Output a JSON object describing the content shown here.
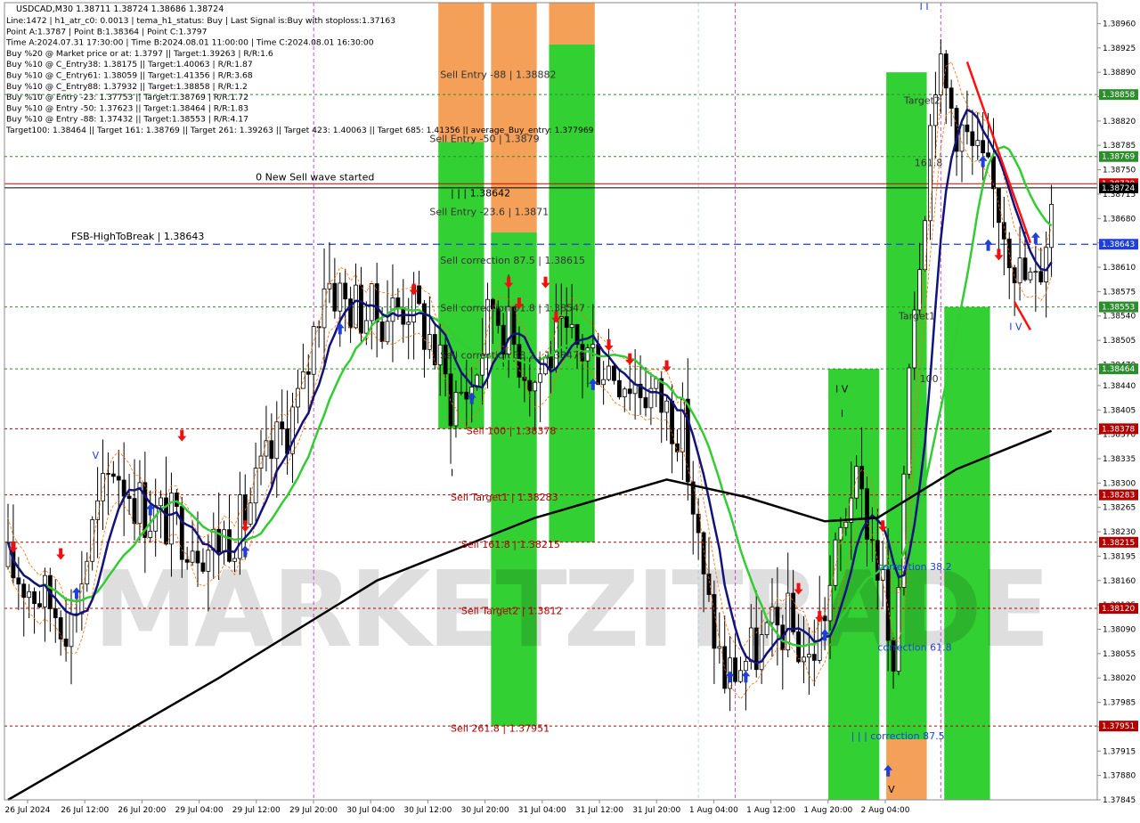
{
  "title": "USDCAD,M30  1.38711 1.38724 1.38686 1.38724",
  "info_lines": [
    "Line:1472 | h1_atr_c0: 0.0013 | tema_h1_status: Buy | Last Signal is:Buy with stoploss:1.37163",
    "Point A:1.3787 | Point B:1.38364 | Point C:1.3797",
    "Time A:2024.07.31 17:30:00 | Time B:2024.08.01 11:00:00 | Time C:2024.08.01 16:30:00",
    "Buy %20 @ Market price or at: 1.3797 || Target:1.39263 | R/R:1.6",
    "Buy %10 @ C_Entry38: 1.38175 || Target:1.40063 | R/R:1.87",
    "Buy %10 @ C_Entry61: 1.38059 || Target:1.41356 | R/R:3.68",
    "Buy %10 @ C_Entry88: 1.37932 || Target:1.38858 | R/R:1.2",
    "Buy %10 @ Entry -23: 1.37753 || Target:1.38769 | R/R:1.72",
    "Buy %10 @ Entry -50: 1.37623 || Target:1.38464 | R/R:1.83",
    "Buy %10 @ Entry -88: 1.37432 || Target:1.38553 | R/R:4.17",
    "Target100: 1.38464 || Target 161: 1.38769 || Target 261: 1.39263 || Target 423: 1.40063 || Target 685: 1.41356 || average_Buy_entry: 1.377969"
  ],
  "chart_data": {
    "type": "candlestick",
    "symbol": "USDCAD",
    "timeframe": "M30",
    "ylim": [
      1.37845,
      1.3899
    ],
    "y_ticks": [
      "1.38960",
      "1.38925",
      "1.38890",
      "1.38855",
      "1.38820",
      "1.38785",
      "1.38750",
      "1.38715",
      "1.38680",
      "1.38645",
      "1.38610",
      "1.38575",
      "1.38540",
      "1.38505",
      "1.38470",
      "1.38440",
      "1.38405",
      "1.38370",
      "1.38335",
      "1.38300",
      "1.38265",
      "1.38230",
      "1.38195",
      "1.38160",
      "1.38125",
      "1.38090",
      "1.38055",
      "1.38020",
      "1.37985",
      "1.37950",
      "1.37915",
      "1.37880",
      "1.37845"
    ],
    "x_ticks": [
      "26 Jul 2024",
      "26 Jul 12:00",
      "26 Jul 20:00",
      "29 Jul 04:00",
      "29 Jul 12:00",
      "29 Jul 20:00",
      "30 Jul 04:00",
      "30 Jul 12:00",
      "30 Jul 20:00",
      "31 Jul 04:00",
      "31 Jul 12:00",
      "31 Jul 20:00",
      "1 Aug 04:00",
      "1 Aug 12:00",
      "1 Aug 20:00",
      "2 Aug 04:00"
    ],
    "levels": [
      {
        "price": 1.38858,
        "label": "1.38858",
        "color": "#2e8b2e",
        "style": "dotted"
      },
      {
        "price": 1.38769,
        "label": "1.38769",
        "color": "#2e8b2e",
        "style": "dotted"
      },
      {
        "price": 1.3873,
        "label": "1.38730",
        "color": "#d40000",
        "style": "solid"
      },
      {
        "price": 1.38724,
        "label": "1.38724",
        "color": "#000000",
        "style": "solid"
      },
      {
        "price": 1.38643,
        "label": "1.38643",
        "color": "#1f3fd8",
        "style": "dashed"
      },
      {
        "price": 1.38553,
        "label": "1.38553",
        "color": "#2e8b2e",
        "style": "dotted"
      },
      {
        "price": 1.38464,
        "label": "1.38464",
        "color": "#2e8b2e",
        "style": "dotted"
      },
      {
        "price": 1.38378,
        "label": "1.38378",
        "color": "#b00000",
        "style": "dotted"
      },
      {
        "price": 1.38283,
        "label": "1.38283",
        "color": "#b00000",
        "style": "dotted"
      },
      {
        "price": 1.38215,
        "label": "1.38215",
        "color": "#b00000",
        "style": "dotted"
      },
      {
        "price": 1.3812,
        "label": "1.38120",
        "color": "#b00000",
        "style": "dotted"
      },
      {
        "price": 1.37951,
        "label": "1.37951",
        "color": "#b00000",
        "style": "dotted"
      }
    ],
    "zones": [
      {
        "color": "#f08020",
        "i0": 82,
        "i1": 90,
        "top": 1.3899,
        "bottom": 1.38378,
        "split": 1.3879
      },
      {
        "color": "#f08020",
        "i0": 92,
        "i1": 100,
        "top": 1.3899,
        "bottom": 1.37951,
        "split": 1.3866
      },
      {
        "color": "#f08020",
        "i0": 103,
        "i1": 111,
        "top": 1.3899,
        "bottom": 1.38215,
        "split": 1.3893
      },
      {
        "color": "#22cc22",
        "i0": 156,
        "i1": 165,
        "top": 1.38464,
        "bottom": 1.37845,
        "split": null
      },
      {
        "color": "#22cc22",
        "i0": 167,
        "i1": 174,
        "top": 1.3889,
        "bottom": 1.37845,
        "split": 1.37932,
        "low_color": "#f08020"
      },
      {
        "color": "#22cc22",
        "i0": 178,
        "i1": 186,
        "top": 1.38553,
        "bottom": 1.37845,
        "split": null
      }
    ],
    "labels": [
      {
        "text": "Sell Entry -88 | 1.38882",
        "i": 82,
        "price": 1.38882,
        "color": "#333333"
      },
      {
        "text": "Sell Entry -50 | 1.3879",
        "i": 80,
        "price": 1.3879,
        "color": "#333333"
      },
      {
        "text": "| | | 1.38642",
        "i": 84,
        "price": 1.38712,
        "color": "#000000"
      },
      {
        "text": "Sell Entry -23.6 | 1.3871",
        "i": 80,
        "price": 1.38685,
        "color": "#333333"
      },
      {
        "text": "0 New Sell wave started",
        "i": 47,
        "price": 1.38735,
        "color": "#000000"
      },
      {
        "text": "FSB-HighToBreak | 1.38643",
        "i": 12,
        "price": 1.3865,
        "color": "#000000"
      },
      {
        "text": "Sell correction 87.5 | 1.38615",
        "i": 82,
        "price": 1.38615,
        "color": "#333333"
      },
      {
        "text": "Sell correction 61.8 | 1.38547",
        "i": 82,
        "price": 1.38547,
        "color": "#333333"
      },
      {
        "text": "Sell correction 38.2 | 1.38479",
        "i": 82,
        "price": 1.38479,
        "color": "#333333"
      },
      {
        "text": "Sell 100 | 1.38378",
        "i": 87,
        "price": 1.3837,
        "color": "#b00000"
      },
      {
        "text": "Sell Target1 | 1.38283",
        "i": 84,
        "price": 1.38275,
        "color": "#b00000"
      },
      {
        "text": "Sell 161.8 | 1.38215",
        "i": 86,
        "price": 1.38207,
        "color": "#b00000"
      },
      {
        "text": "Sell Target2 | 1.3812",
        "i": 86,
        "price": 1.38112,
        "color": "#b00000"
      },
      {
        "text": "Sell  261.8 | 1.37951",
        "i": 84,
        "price": 1.37943,
        "color": "#b00000"
      },
      {
        "text": "Target2",
        "i": 170,
        "price": 1.38845,
        "color": "#333333"
      },
      {
        "text": "161.8",
        "i": 172,
        "price": 1.38755,
        "color": "#333333"
      },
      {
        "text": "Target1",
        "i": 169,
        "price": 1.38535,
        "color": "#333333"
      },
      {
        "text": "100",
        "i": 173,
        "price": 1.38445,
        "color": "#333333"
      },
      {
        "text": "correction 38.2",
        "i": 165,
        "price": 1.38175,
        "color": "#1f3fd8"
      },
      {
        "text": "correction 61.8",
        "i": 165,
        "price": 1.38059,
        "color": "#1f3fd8"
      },
      {
        "text": "| | | correction 87.5",
        "i": 160,
        "price": 1.37932,
        "color": "#1f3fd8"
      },
      {
        "text": "I V",
        "i": 157,
        "price": 1.3843,
        "color": "#000000"
      },
      {
        "text": "I",
        "i": 158,
        "price": 1.38395,
        "color": "#000000"
      },
      {
        "text": "V",
        "i": 16,
        "price": 1.38335,
        "color": "#1f3fd8"
      },
      {
        "text": "I",
        "i": 84,
        "price": 1.3831,
        "color": "#000000"
      },
      {
        "text": "I I",
        "i": 173,
        "price": 1.3898,
        "color": "#1f3fd8"
      },
      {
        "text": "I V",
        "i": 190,
        "price": 1.3852,
        "color": "#1f3fd8"
      },
      {
        "text": "V",
        "i": 167,
        "price": 1.37855,
        "color": "#000000"
      }
    ],
    "buy_arrows": [
      [
        13,
        1.3814
      ],
      [
        27,
        1.3826
      ],
      [
        45,
        1.382
      ],
      [
        63,
        1.3852
      ],
      [
        88,
        1.3842
      ],
      [
        111,
        1.3844
      ],
      [
        137,
        1.3802
      ],
      [
        140,
        1.3802
      ],
      [
        155,
        1.3808
      ],
      [
        167,
        1.37885
      ],
      [
        185,
        1.3876
      ],
      [
        186,
        1.3864
      ],
      [
        195,
        1.3865
      ]
    ],
    "sell_arrows": [
      [
        1,
        1.3821
      ],
      [
        10,
        1.382
      ],
      [
        33,
        1.3837
      ],
      [
        45,
        1.3824
      ],
      [
        77,
        1.3858
      ],
      [
        95,
        1.3859
      ],
      [
        102,
        1.3859
      ],
      [
        97,
        1.3856
      ],
      [
        104,
        1.3854
      ],
      [
        114,
        1.385
      ],
      [
        118,
        1.3848
      ],
      [
        125,
        1.3847
      ],
      [
        150,
        1.3815
      ],
      [
        154,
        1.3811
      ],
      [
        166,
        1.3824
      ],
      [
        188,
        1.3863
      ]
    ],
    "tail_high_low": {
      "high": 1.3896,
      "low": 1.37845
    }
  },
  "watermark": "MARKETZITRADE"
}
